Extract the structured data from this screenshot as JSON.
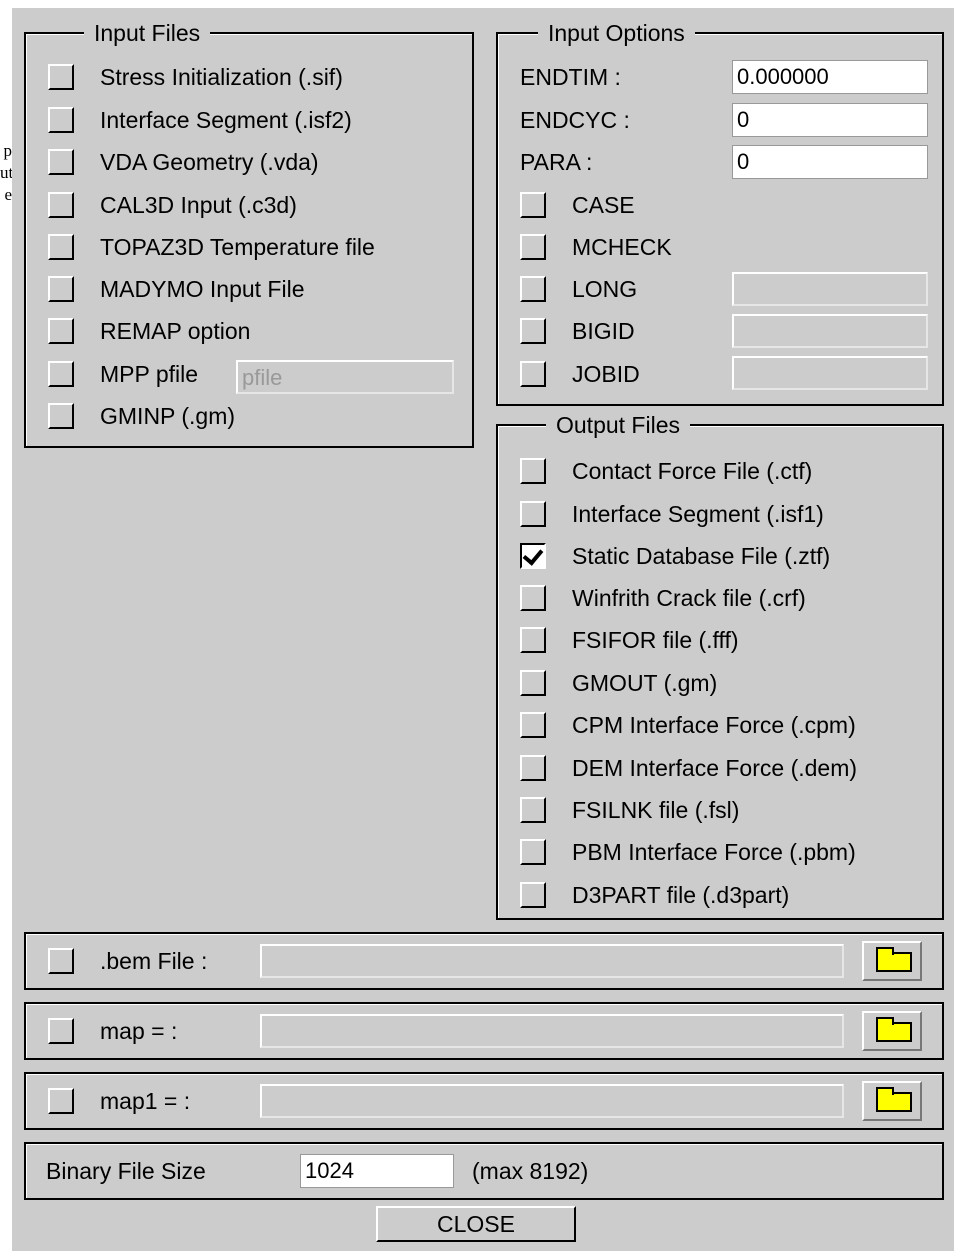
{
  "left_clip": [
    "p",
    "ut",
    "e"
  ],
  "input_files": {
    "title": "Input Files",
    "items": [
      {
        "label": "Stress Initialization (.sif)",
        "checked": false
      },
      {
        "label": "Interface Segment (.isf2)",
        "checked": false
      },
      {
        "label": "VDA Geometry (.vda)",
        "checked": false
      },
      {
        "label": "CAL3D Input (.c3d)",
        "checked": false
      },
      {
        "label": "TOPAZ3D Temperature file",
        "checked": false
      },
      {
        "label": "MADYMO Input File",
        "checked": false
      },
      {
        "label": "REMAP option",
        "checked": false
      },
      {
        "label": "MPP pfile",
        "checked": false
      },
      {
        "label": "GMINP (.gm)",
        "checked": false
      }
    ],
    "pfile_value": "pfile"
  },
  "input_options": {
    "title": "Input Options",
    "fields": [
      {
        "label": "ENDTIM :",
        "value": "0.000000"
      },
      {
        "label": "ENDCYC :",
        "value": "0"
      },
      {
        "label": "PARA :",
        "value": "0"
      }
    ],
    "checks": [
      {
        "label": "CASE",
        "checked": false
      },
      {
        "label": "MCHECK",
        "checked": false
      },
      {
        "label": "LONG",
        "checked": false,
        "value": ""
      },
      {
        "label": "BIGID",
        "checked": false,
        "value": ""
      },
      {
        "label": "JOBID",
        "checked": false,
        "value": ""
      }
    ]
  },
  "output_files": {
    "title": "Output Files",
    "items": [
      {
        "label": "Contact Force File (.ctf)",
        "checked": false
      },
      {
        "label": "Interface Segment (.isf1)",
        "checked": false
      },
      {
        "label": "Static Database File (.ztf)",
        "checked": true
      },
      {
        "label": "Winfrith Crack file (.crf)",
        "checked": false
      },
      {
        "label": "FSIFOR file (.fff)",
        "checked": false
      },
      {
        "label": "GMOUT (.gm)",
        "checked": false
      },
      {
        "label": "CPM Interface Force (.cpm)",
        "checked": false
      },
      {
        "label": "DEM Interface Force (.dem)",
        "checked": false
      },
      {
        "label": "FSILNK file (.fsl)",
        "checked": false
      },
      {
        "label": "PBM Interface Force (.pbm)",
        "checked": false
      },
      {
        "label": "D3PART file (.d3part)",
        "checked": false
      }
    ]
  },
  "file_rows": [
    {
      "label": ".bem File :",
      "value": "",
      "icon": "folder-icon"
    },
    {
      "label": "map = :",
      "value": "",
      "icon": "folder-icon"
    },
    {
      "label": "map1 = :",
      "value": "",
      "icon": "folder-icon"
    }
  ],
  "binary": {
    "label": "Binary File Size",
    "value": "1024",
    "note": "(max 8192)"
  },
  "close_label": "CLOSE",
  "colors": {
    "background": "#cccccc",
    "folder": "#ffff00"
  }
}
